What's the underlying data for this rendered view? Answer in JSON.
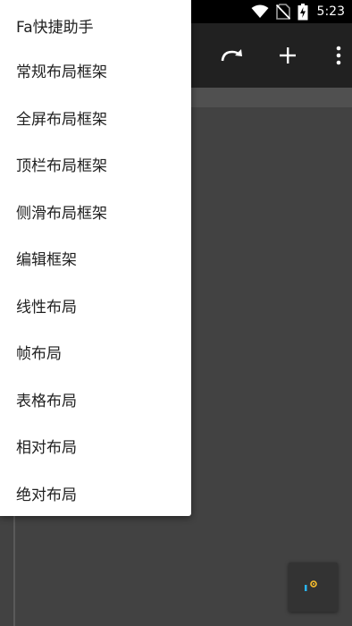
{
  "status_bar": {
    "time": "5:23",
    "icons": [
      "wifi-icon",
      "no-sim-icon",
      "battery-charging-icon"
    ]
  },
  "toolbar": {
    "icons": [
      "redo-icon",
      "add-icon",
      "more-vert-icon"
    ]
  },
  "menu": {
    "items": [
      {
        "label": "Fa快捷助手"
      },
      {
        "label": "常规布局框架"
      },
      {
        "label": "全屏布局框架"
      },
      {
        "label": "顶栏布局框架"
      },
      {
        "label": "侧滑布局框架"
      },
      {
        "label": "编辑框架"
      },
      {
        "label": "线性布局"
      },
      {
        "label": "帧布局"
      },
      {
        "label": "表格布局"
      },
      {
        "label": "相对布局"
      },
      {
        "label": "绝对布局"
      }
    ]
  },
  "colors": {
    "status_bar": "#000000",
    "toolbar": "#212121",
    "canvas": "#424242",
    "menu_bg": "#ffffff",
    "menu_text": "#212121",
    "accent_blue": "#29b6f6",
    "accent_yellow": "#fbc02d"
  }
}
